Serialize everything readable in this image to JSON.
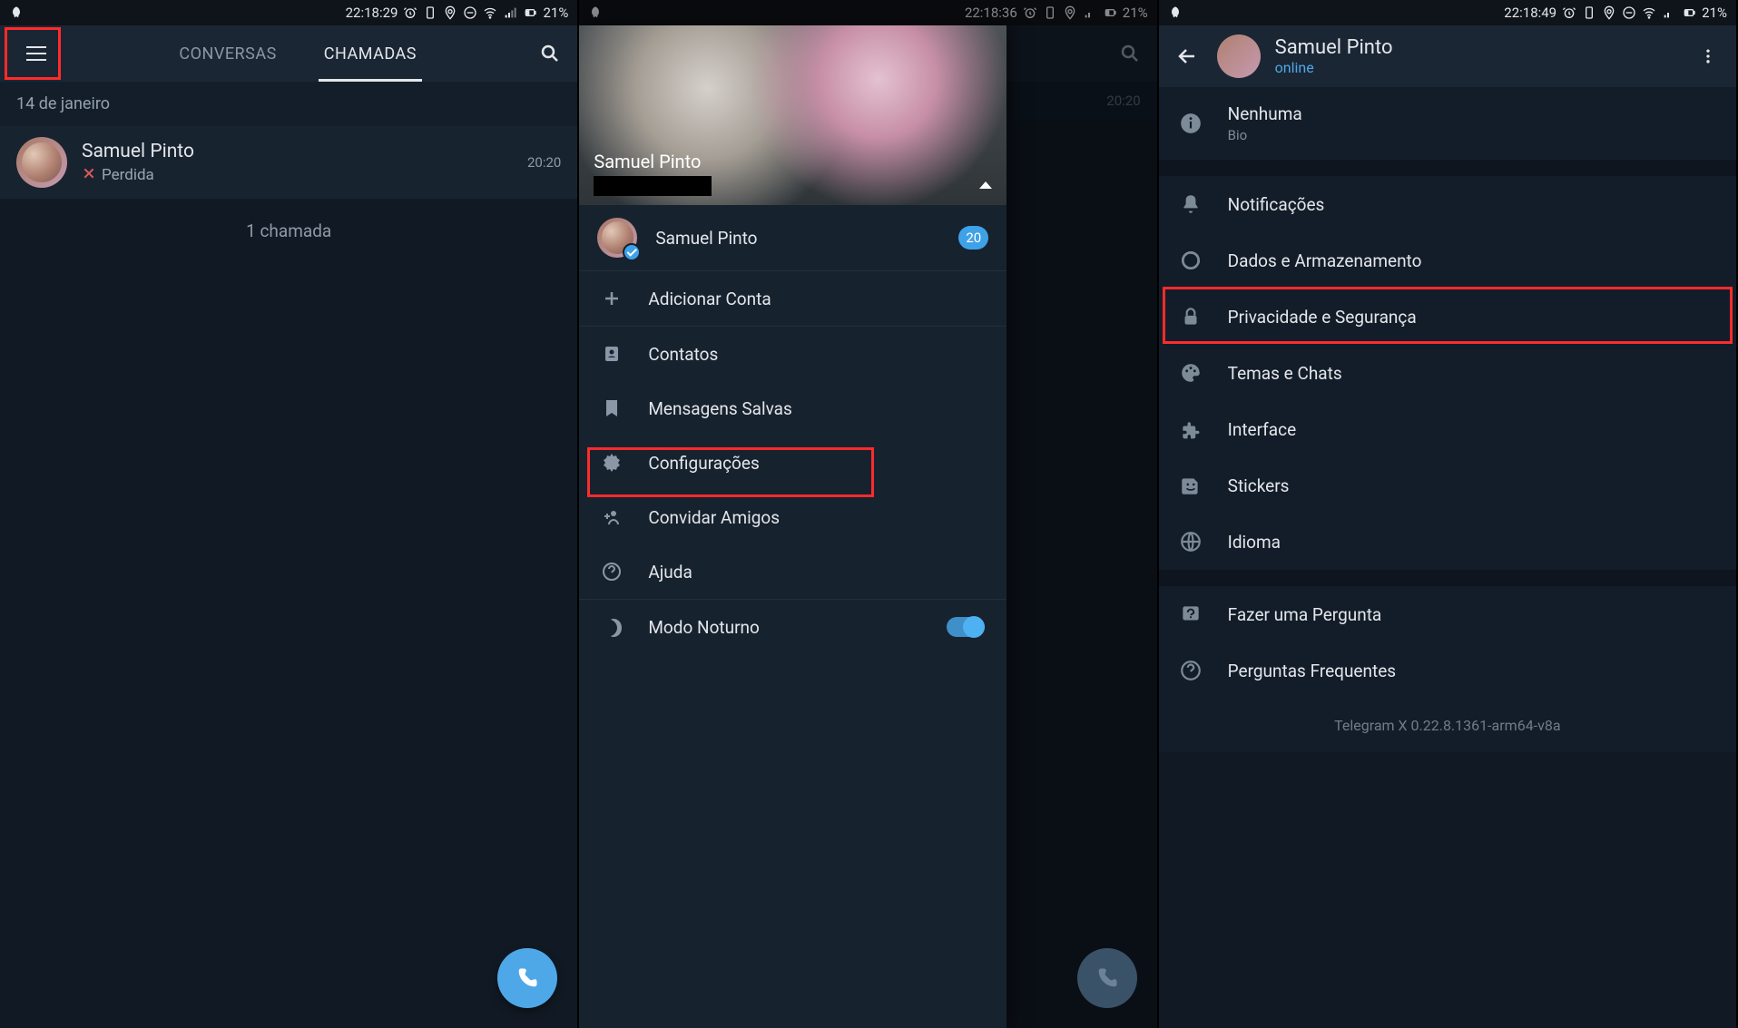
{
  "status_bar": {
    "times": [
      "22:18:29",
      "22:18:36",
      "22:18:49"
    ],
    "battery": "21%"
  },
  "screen1": {
    "tabs": {
      "conversas": "CONVERSAS",
      "chamadas": "CHAMADAS"
    },
    "date_label": "14 de janeiro",
    "call": {
      "name": "Samuel Pinto",
      "status": "Perdida",
      "time": "20:20"
    },
    "count": "1 chamada"
  },
  "screen2": {
    "bg_call": {
      "name": "Samuel Pinto",
      "time": "20:20"
    },
    "drawer": {
      "header_name": "Samuel Pinto",
      "account_name": "Samuel Pinto",
      "badge": "20",
      "add_account": "Adicionar Conta",
      "contacts": "Contatos",
      "saved": "Mensagens Salvas",
      "settings": "Configurações",
      "invite": "Convidar Amigos",
      "help": "Ajuda",
      "night": "Modo Noturno"
    }
  },
  "screen3": {
    "header": {
      "name": "Samuel Pinto",
      "status": "online"
    },
    "bio": {
      "value": "Nenhuma",
      "label": "Bio"
    },
    "items": {
      "notifications": "Notificações",
      "data_storage": "Dados e Armazenamento",
      "privacy": "Privacidade e Segurança",
      "themes": "Temas e Chats",
      "interface": "Interface",
      "stickers": "Stickers",
      "language": "Idioma",
      "ask": "Fazer uma Pergunta",
      "faq": "Perguntas Frequentes"
    },
    "version": "Telegram X 0.22.8.1361-arm64-v8a"
  }
}
